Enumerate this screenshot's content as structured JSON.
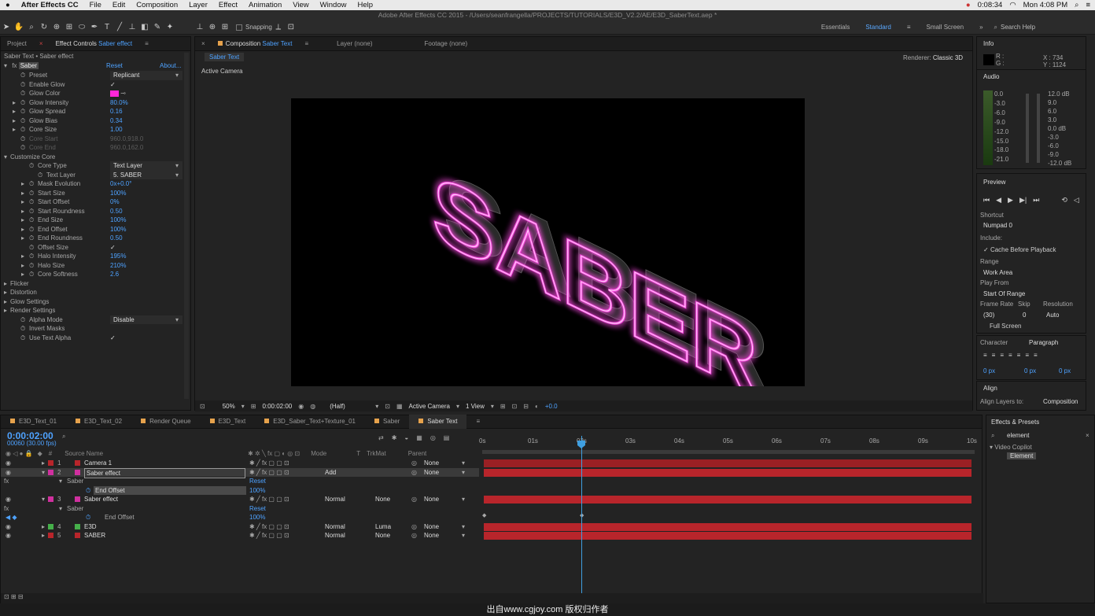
{
  "menubar": {
    "apple": "",
    "app": "After Effects CC",
    "items": [
      "File",
      "Edit",
      "Composition",
      "Layer",
      "Effect",
      "Animation",
      "View",
      "Window",
      "Help"
    ],
    "time": "0:08:34",
    "clock": "Mon 4:08 PM"
  },
  "title": "Adobe After Effects CC 2015 - /Users/seanfrangella/PROJECTS/TUTORIALS/E3D_V2.2/AE/E3D_SaberText.aep *",
  "toolbar": {
    "snapping": "Snapping",
    "workspaces": [
      "Essentials",
      "Standard",
      "Small Screen"
    ],
    "search": "Search Help"
  },
  "left_panel": {
    "tabs": [
      "Project",
      "Effect Controls",
      "Saber effect"
    ],
    "breadcrumb": "Saber Text • Saber effect",
    "effect": "Saber",
    "reset": "Reset",
    "about": "About...",
    "rows": [
      {
        "l": "Preset",
        "v": "Replicant",
        "t": "dd",
        "i": 1
      },
      {
        "l": "Enable Glow",
        "v": "✓",
        "i": 1
      },
      {
        "l": "Glow Color",
        "v": "",
        "t": "color",
        "i": 1
      },
      {
        "l": "Glow Intensity",
        "v": "80.0%",
        "i": 1,
        "tw": 1
      },
      {
        "l": "Glow Spread",
        "v": "0.16",
        "i": 1,
        "tw": 1
      },
      {
        "l": "Glow Bias",
        "v": "0.34",
        "i": 1,
        "tw": 1
      },
      {
        "l": "Core Size",
        "v": "1.00",
        "i": 1,
        "tw": 1
      },
      {
        "l": "Core Start",
        "v": "960.0,918.0",
        "i": 1,
        "dim": 1
      },
      {
        "l": "Core End",
        "v": "960.0,162.0",
        "i": 1,
        "dim": 1
      },
      {
        "l": "Customize Core",
        "v": "",
        "i": 0,
        "tw": 2
      },
      {
        "l": "Core Type",
        "v": "Text Layer",
        "t": "dd",
        "i": 2
      },
      {
        "l": "Text Layer",
        "v": "5. SABER",
        "t": "dd",
        "i": 3
      },
      {
        "l": "Mask Evolution",
        "v": "0x+0.0°",
        "i": 2,
        "tw": 1
      },
      {
        "l": "Start Size",
        "v": "100%",
        "i": 2,
        "tw": 1
      },
      {
        "l": "Start Offset",
        "v": "0%",
        "i": 2,
        "tw": 1
      },
      {
        "l": "Start Roundness",
        "v": "0.50",
        "i": 2,
        "tw": 1
      },
      {
        "l": "End Size",
        "v": "100%",
        "i": 2,
        "tw": 1
      },
      {
        "l": "End Offset",
        "v": "100%",
        "i": 2,
        "tw": 1
      },
      {
        "l": "End Roundness",
        "v": "0.50",
        "i": 2,
        "tw": 1
      },
      {
        "l": "Offset Size",
        "v": "✓",
        "i": 2
      },
      {
        "l": "Halo Intensity",
        "v": "195%",
        "i": 2,
        "tw": 1
      },
      {
        "l": "Halo Size",
        "v": "210%",
        "i": 2,
        "tw": 1
      },
      {
        "l": "Core Softness",
        "v": "2.6",
        "i": 2,
        "tw": 1
      },
      {
        "l": "Flicker",
        "v": "",
        "i": 0,
        "tw": 1
      },
      {
        "l": "Distortion",
        "v": "",
        "i": 0,
        "tw": 1
      },
      {
        "l": "Glow Settings",
        "v": "",
        "i": 0,
        "tw": 1
      },
      {
        "l": "Render Settings",
        "v": "",
        "i": 0,
        "tw": 1
      },
      {
        "l": "Alpha Mode",
        "v": "Disable",
        "t": "dd",
        "i": 1
      },
      {
        "l": "Invert Masks",
        "v": "",
        "i": 1
      },
      {
        "l": "Use Text Alpha",
        "v": "✓",
        "i": 1
      }
    ]
  },
  "comp": {
    "tabs": [
      "Composition",
      "Saber Text",
      "Layer (none)",
      "Footage (none)"
    ],
    "subtab": "Saber Text",
    "renderer_label": "Renderer:",
    "renderer": "Classic 3D",
    "camera_label": "Active Camera",
    "text": "SABER",
    "footer": {
      "zoom": "50%",
      "time": "0:00:02:00",
      "res": "(Half)",
      "view": "Active Camera",
      "views": "1 View",
      "exposure": "+0.0"
    }
  },
  "timeline": {
    "tabs": [
      "E3D_Text_01",
      "E3D_Text_02",
      "Render Queue",
      "E3D_Text",
      "E3D_Saber_Text+Texture_01",
      "Saber",
      "Saber Text"
    ],
    "timecode": "0:00:02:00",
    "frames": "00060 (30.00 fps)",
    "col_source": "Source Name",
    "col_mode": "Mode",
    "col_t": "T",
    "col_trkmat": "TrkMat",
    "col_parent": "Parent",
    "ticks": [
      "0s",
      "01s",
      "02s",
      "03s",
      "04s",
      "05s",
      "06s",
      "07s",
      "08s",
      "09s",
      "10s"
    ],
    "layers": [
      {
        "n": "1",
        "name": "Camera 1",
        "mode": "",
        "trk": "",
        "parent": "None",
        "color": "#b8252b"
      },
      {
        "n": "2",
        "name": "Saber effect",
        "mode": "Add",
        "trk": "",
        "parent": "None",
        "color": "#d0309f",
        "sel": 1
      },
      {
        "n": "3",
        "name": "Saber effect",
        "mode": "Normal",
        "trk": "None",
        "parent": "None",
        "color": "#d0309f"
      },
      {
        "n": "4",
        "name": "E3D",
        "mode": "Normal",
        "trk": "Luma",
        "parent": "None",
        "color": "#45b04a"
      },
      {
        "n": "5",
        "name": "SABER",
        "mode": "Normal",
        "trk": "None",
        "parent": "None",
        "color": "#b8252b"
      }
    ],
    "sub": {
      "effect": "Saber",
      "reset": "Reset",
      "prop": "End Offset",
      "value": "100%"
    }
  },
  "right": {
    "info_title": "Info",
    "info_r": "R :",
    "info_g": "G :",
    "info_x": "X : 734",
    "info_y": "Y : 1124",
    "audio_title": "Audio",
    "audio_left": [
      "0.0",
      "-3.0",
      "-6.0",
      "-9.0",
      "-12.0",
      "-15.0",
      "-18.0",
      "-21.0"
    ],
    "audio_right": [
      "12.0 dB",
      "9.0",
      "6.0",
      "3.0",
      "0.0 dB",
      "-3.0",
      "-6.0",
      "-9.0",
      "-12.0 dB"
    ],
    "preview_title": "Preview",
    "shortcut": "Shortcut",
    "shortcut_val": "Numpad 0",
    "include": "Include:",
    "cache": "Cache Before Playback",
    "range": "Range",
    "range_val": "Work Area",
    "playfrom": "Play From",
    "playfrom_val": "Start Of Range",
    "fr": "Frame Rate",
    "skip": "Skip",
    "resolution": "Resolution",
    "fr_val": "(30)",
    "skip_val": "0",
    "res_val": "Auto",
    "fullscreen": "Full Screen",
    "character": "Character",
    "paragraph": "Paragraph",
    "px": "0 px",
    "align_title": "Align",
    "align_to": "Align Layers to:",
    "align_val": "Composition",
    "effects_title": "Effects & Presets",
    "search_val": "element",
    "category": "Video Copilot",
    "item": "Element"
  },
  "watermark": "出自www.cgjoy.com 版权归作者"
}
